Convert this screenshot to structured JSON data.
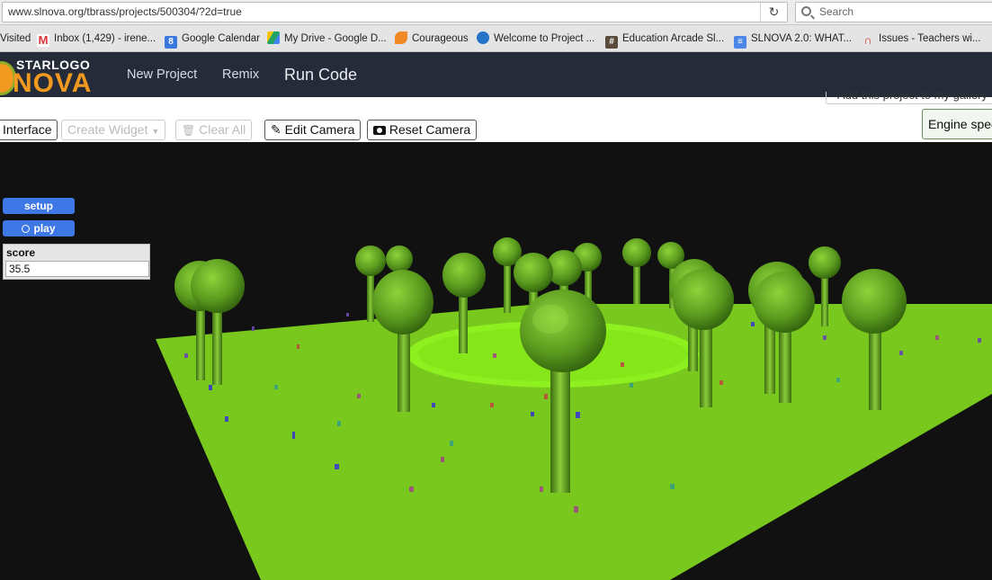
{
  "browser": {
    "url": "www.slnova.org/tbrass/projects/500304/?2d=true",
    "search_placeholder": "Search"
  },
  "bookmarks": [
    {
      "label": "Visited",
      "icon": "none"
    },
    {
      "label": "Inbox (1,429) - irene...",
      "icon": "gmail-icon"
    },
    {
      "label": "Google Calendar",
      "icon": "calendar-icon"
    },
    {
      "label": "My Drive - Google D...",
      "icon": "drive-icon"
    },
    {
      "label": "Courageous",
      "icon": "flame-icon"
    },
    {
      "label": "Welcome to Project ...",
      "icon": "drupal-icon"
    },
    {
      "label": "Education Arcade Sl...",
      "icon": "hash-icon"
    },
    {
      "label": "SLNOVA 2.0: WHAT...",
      "icon": "doc-icon"
    },
    {
      "label": "Issues - Teachers wi...",
      "icon": "rainbow-icon"
    }
  ],
  "app": {
    "logo_top": "STARLOGO",
    "logo_big": "NOVA",
    "nav": {
      "new_project": "New Project",
      "remix": "Remix",
      "run_code": "Run Code"
    }
  },
  "toolbar": {
    "gallery": "Add this project to my gallery",
    "interface": "Interface",
    "create_widget": "Create Widget",
    "clear_all": "Clear All",
    "edit_camera": "Edit Camera",
    "reset_camera": "Reset Camera",
    "engine": "Engine speed"
  },
  "widgets": {
    "setup": "setup",
    "play": "play",
    "score_label": "score",
    "score_value": "35.5"
  },
  "colors": {
    "header_bg": "#252b38",
    "widget_blue": "#3e77e6",
    "ground": "#78c81e",
    "ground_center": "#8ef01e"
  }
}
